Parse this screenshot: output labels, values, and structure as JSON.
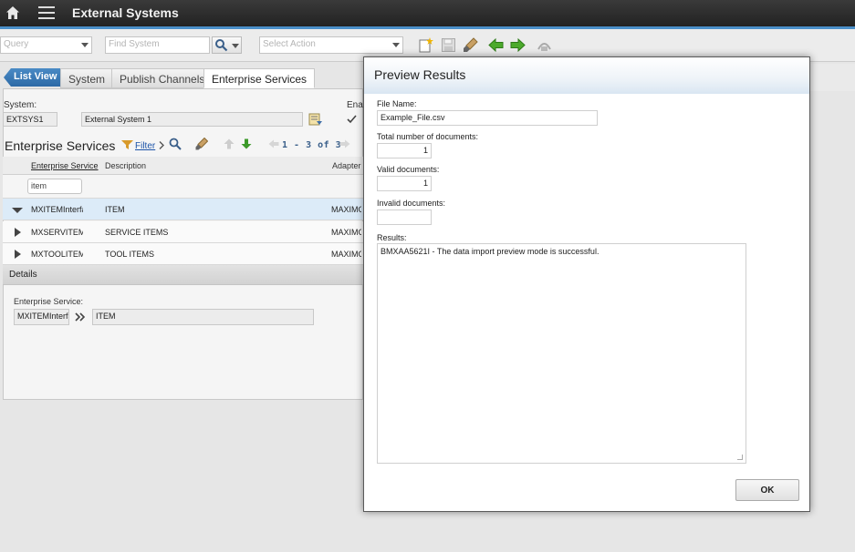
{
  "app": {
    "title": "External Systems"
  },
  "toolbar": {
    "query_placeholder": "Query",
    "find_placeholder": "Find System",
    "action_placeholder": "Select Action"
  },
  "tabs": [
    "List View",
    "System",
    "Publish Channels",
    "Enterprise Services"
  ],
  "system": {
    "label": "System:",
    "id": "EXTSYS1",
    "description": "External System 1",
    "enabled_label": "Enab"
  },
  "section": {
    "title": "Enterprise Services",
    "filter_label": "Filter",
    "pagination": "1 - 3 of 3"
  },
  "table": {
    "headers": [
      "Enterprise Service",
      "Description",
      "Adapter"
    ],
    "filter_value": "item",
    "rows": [
      {
        "service": "MXITEMInterface",
        "description": "ITEM",
        "adapter": "MAXIMO"
      },
      {
        "service": "MXSERVITEMInterface",
        "description": "SERVICE ITEMS",
        "adapter": "MAXIMO"
      },
      {
        "service": "MXTOOLITEMInterface",
        "description": "TOOL ITEMS",
        "adapter": "MAXIMO"
      }
    ]
  },
  "details": {
    "title": "Details",
    "service_label": "Enterprise Service:",
    "service_value": "MXITEMInterface",
    "service_desc": "ITEM"
  },
  "dialog": {
    "title": "Preview Results",
    "file_label": "File Name:",
    "file_value": "Example_File.csv",
    "total_label": "Total number of documents:",
    "total_value": "1",
    "valid_label": "Valid documents:",
    "valid_value": "1",
    "invalid_label": "Invalid documents:",
    "invalid_value": "",
    "results_label": "Results:",
    "results_value": "BMXAA5621I - The data import preview mode is successful.",
    "ok_label": "OK"
  },
  "colors": {
    "accent": "#4a8fc8",
    "link": "#1b53a8",
    "topbar": "#2b2b2b"
  },
  "icons": [
    "home-icon",
    "menu-icon",
    "search-icon",
    "new-record-icon",
    "save-icon",
    "clear-icon",
    "previous-icon",
    "next-icon",
    "route-icon",
    "detail-menu-icon",
    "filter-icon",
    "edit-icon",
    "arrow-up-icon",
    "arrow-down-icon",
    "chevron-right-icon"
  ]
}
